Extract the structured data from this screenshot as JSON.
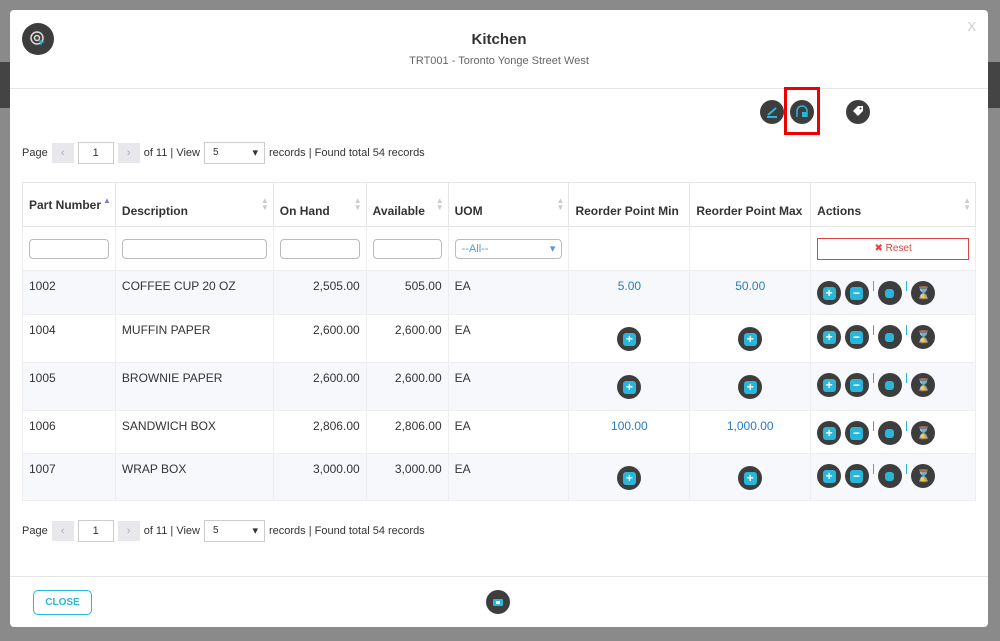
{
  "header": {
    "title": "Kitchen",
    "subtitle": "TRT001 - Toronto Yonge Street West",
    "close_icon": "X"
  },
  "pager": {
    "page_label": "Page",
    "prev": "‹",
    "page": "1",
    "next": "›",
    "of": "of 11 | View",
    "view": "5",
    "found": "records | Found total 54 records"
  },
  "table": {
    "columns": [
      "Part Number",
      "Description",
      "On Hand",
      "Available",
      "UOM",
      "Reorder Point Min",
      "Reorder Point Max",
      "Actions"
    ],
    "uom_filter": "--All--",
    "reset_label": "✖ Reset",
    "rows": [
      {
        "part": "1002",
        "desc": "COFFEE CUP 20 OZ",
        "onhand": "2,505.00",
        "avail": "505.00",
        "uom": "EA",
        "min": "5.00",
        "max": "50.00"
      },
      {
        "part": "1004",
        "desc": "MUFFIN PAPER",
        "onhand": "2,600.00",
        "avail": "2,600.00",
        "uom": "EA",
        "min": null,
        "max": null
      },
      {
        "part": "1005",
        "desc": "BROWNIE PAPER",
        "onhand": "2,600.00",
        "avail": "2,600.00",
        "uom": "EA",
        "min": null,
        "max": null
      },
      {
        "part": "1006",
        "desc": "SANDWICH BOX",
        "onhand": "2,806.00",
        "avail": "2,806.00",
        "uom": "EA",
        "min": "100.00",
        "max": "1,000.00"
      },
      {
        "part": "1007",
        "desc": "WRAP BOX",
        "onhand": "3,000.00",
        "avail": "3,000.00",
        "uom": "EA",
        "min": null,
        "max": null
      }
    ]
  },
  "footer": {
    "close": "CLOSE"
  }
}
